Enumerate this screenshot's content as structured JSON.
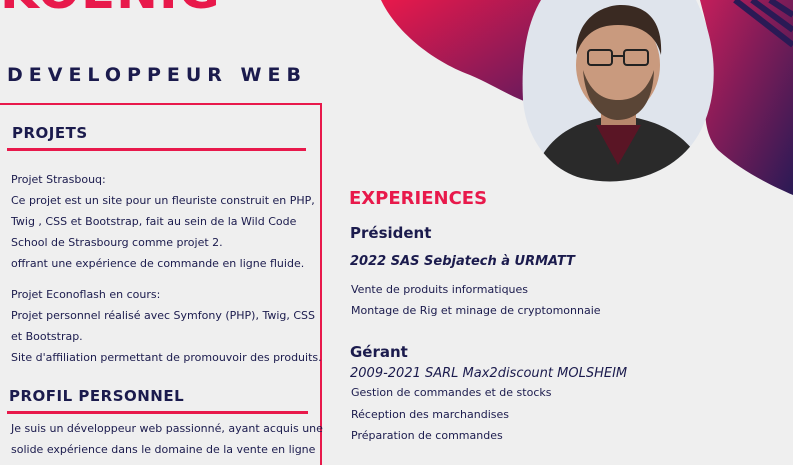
{
  "header": {
    "name": "KOENIG",
    "job_title": "DEVELOPPEUR WEB"
  },
  "colors": {
    "accent": "#e8194b",
    "navy": "#1b1b4d",
    "background": "#efefef"
  },
  "projects": {
    "title": "PROJETS",
    "lines": [
      "Projet Strasbouq:",
      "Ce projet est un site pour un fleuriste construit en PHP,",
      "Twig , CSS et Bootstrap, fait au sein de la Wild Code",
      "School de Strasbourg comme projet 2.",
      "offrant une expérience de commande en ligne fluide.",
      "",
      "Projet Econoflash en cours:",
      "Projet personnel réalisé avec Symfony (PHP), Twig, CSS",
      "et Bootstrap.",
      "Site d'affiliation permettant de promouvoir des produits."
    ]
  },
  "profile": {
    "title": "PROFIL PERSONNEL",
    "lines": [
      "Je suis un développeur web passionné, ayant acquis une",
      "solide expérience dans le domaine de la vente en ligne"
    ]
  },
  "experiences": {
    "title": "EXPERIENCES",
    "items": [
      {
        "role": "Président",
        "period": "2022 SAS Sebjatech à URMATT",
        "tasks": [
          "Vente de produits informatiques",
          "Montage de Rig et minage de cryptomonnaie"
        ]
      },
      {
        "role": "Gérant",
        "period": "2009-2021 SARL Max2discount MOLSHEIM",
        "tasks": [
          "Gestion de commandes et de stocks",
          "Réception des marchandises",
          "Préparation de commandes"
        ]
      }
    ]
  }
}
